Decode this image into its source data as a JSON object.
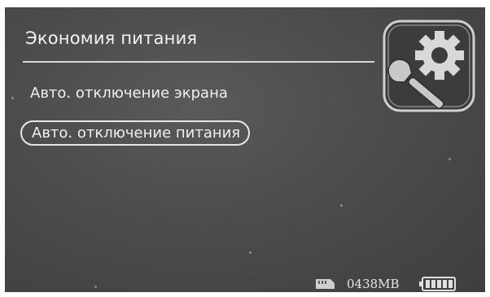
{
  "screen": {
    "title": "Экономия питания",
    "menu": [
      {
        "label": "Авто. отключение экрана",
        "selected": false
      },
      {
        "label": "Авто. отключение питания",
        "selected": true
      }
    ],
    "header_icon": "settings-gear-wrench-icon"
  },
  "status_bar": {
    "storage_icon": "sd-card-icon",
    "storage_text": "0438MB",
    "battery_icon": "battery-full-icon",
    "battery_level": 1.0
  },
  "colors": {
    "screen_bg": "#4c4c4c",
    "text": "#f2f2f2",
    "selection_border": "#e6e6e6"
  }
}
